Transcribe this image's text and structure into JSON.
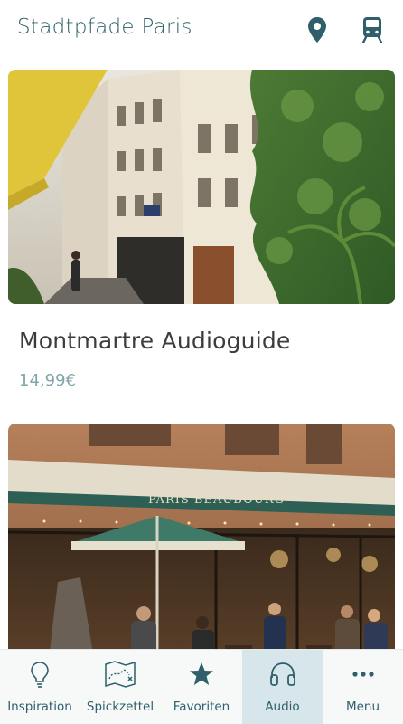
{
  "header": {
    "title": "Stadtpfade Paris",
    "icons": [
      "map-pin-icon",
      "train-icon"
    ]
  },
  "cards": [
    {
      "title": "Montmartre Audioguide",
      "price": "14,99€",
      "image": "street with ivy-covered buildings and yellow awning"
    },
    {
      "title": "",
      "price": "",
      "image": "Paris café terrace",
      "sign_text": "PARIS BEAUBOURG"
    }
  ],
  "tabbar": {
    "active": "Audio",
    "tabs": [
      {
        "label": "Inspiration",
        "icon": "lightbulb-icon"
      },
      {
        "label": "Spickzettel",
        "icon": "map-route-icon"
      },
      {
        "label": "Favoriten",
        "icon": "star-icon"
      },
      {
        "label": "Audio",
        "icon": "headphones-icon"
      },
      {
        "label": "Menu",
        "icon": "more-dots-icon"
      }
    ]
  },
  "colors": {
    "primary": "#2e5f6a",
    "price": "#7fa6ab",
    "active_tab_bg": "#d6e6ea"
  }
}
